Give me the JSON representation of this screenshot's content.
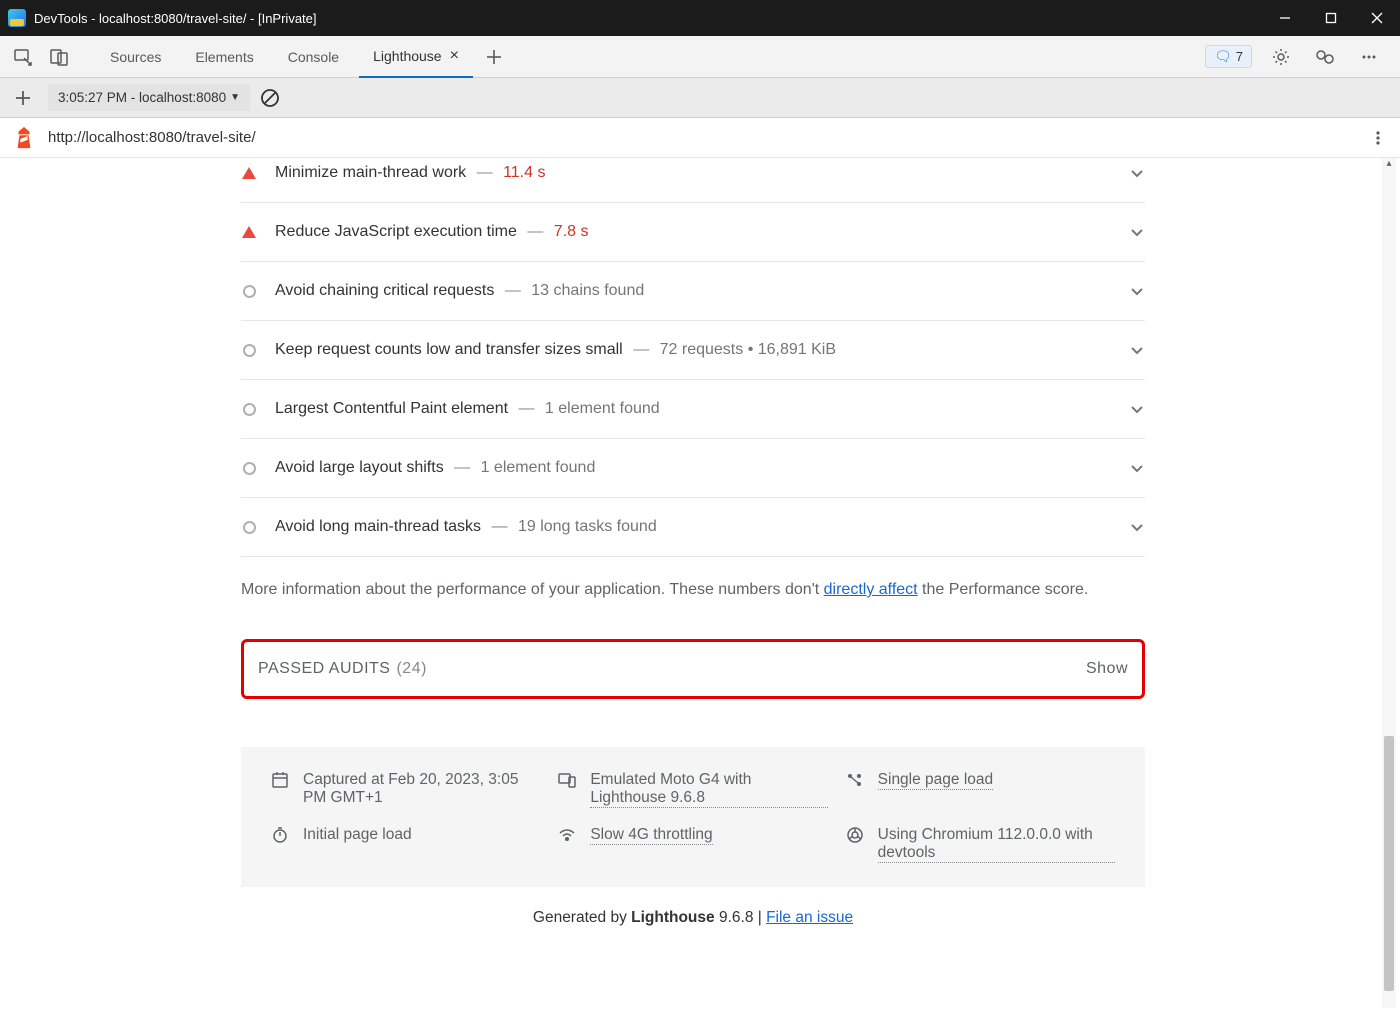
{
  "titlebar": {
    "text": "DevTools - localhost:8080/travel-site/ - [InPrivate]"
  },
  "tabs": {
    "items": [
      "Sources",
      "Elements",
      "Console",
      "Lighthouse"
    ],
    "active_index": 3,
    "badge_count": "7"
  },
  "secondary": {
    "dropdown": "3:05:27 PM - localhost:8080"
  },
  "urlbar": {
    "url": "http://localhost:8080/travel-site/"
  },
  "audits": [
    {
      "kind": "warn",
      "title": "Minimize main-thread work",
      "metric": "11.4 s",
      "metric_class": "red"
    },
    {
      "kind": "warn",
      "title": "Reduce JavaScript execution time",
      "metric": "7.8 s",
      "metric_class": "red"
    },
    {
      "kind": "info",
      "title": "Avoid chaining critical requests",
      "metric": "13 chains found",
      "metric_class": "gray"
    },
    {
      "kind": "info",
      "title": "Keep request counts low and transfer sizes small",
      "metric": "72 requests • 16,891 KiB",
      "metric_class": "gray"
    },
    {
      "kind": "info",
      "title": "Largest Contentful Paint element",
      "metric": "1 element found",
      "metric_class": "gray"
    },
    {
      "kind": "info",
      "title": "Avoid large layout shifts",
      "metric": "1 element found",
      "metric_class": "gray"
    },
    {
      "kind": "info",
      "title": "Avoid long main-thread tasks",
      "metric": "19 long tasks found",
      "metric_class": "gray"
    }
  ],
  "info_line": {
    "pre": "More information about the performance of your application. These numbers don't ",
    "link": "directly affect",
    "post": " the Performance score."
  },
  "passed": {
    "label": "PASSED AUDITS",
    "count": "(24)",
    "action": "Show"
  },
  "runtime": {
    "captured": "Captured at Feb 20, 2023, 3:05 PM GMT+1",
    "emulated": "Emulated Moto G4 with Lighthouse 9.6.8",
    "single": "Single page load",
    "initial": "Initial page load",
    "throttling": "Slow 4G throttling",
    "chromium": "Using Chromium 112.0.0.0 with devtools"
  },
  "footer": {
    "pre": "Generated by ",
    "name": "Lighthouse",
    "version": " 9.6.8 | ",
    "link": "File an issue"
  }
}
